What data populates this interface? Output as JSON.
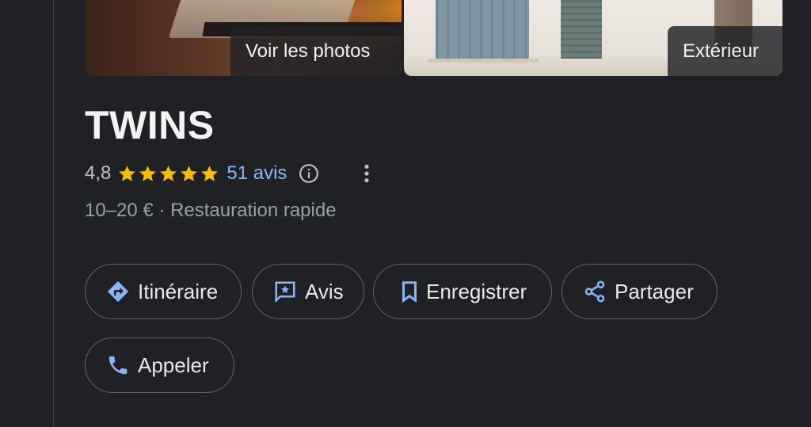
{
  "photos": {
    "primary_label": "Voir les photos",
    "secondary_label": "Extérieur"
  },
  "place": {
    "name": "TWINS",
    "rating": "4,8",
    "stars": 5,
    "reviews_link": "51 avis",
    "price_category": "10–20 € · Restauration rapide"
  },
  "actions": {
    "directions": "Itinéraire",
    "review": "Avis",
    "save": "Enregistrer",
    "share": "Partager",
    "call": "Appeler"
  },
  "icons": {
    "directions": "directions-icon",
    "review": "rate-review-icon",
    "save": "bookmark-icon",
    "share": "share-icon",
    "call": "phone-icon",
    "info": "info-icon",
    "more": "more-vert-icon"
  },
  "colors": {
    "background": "#202124",
    "accent": "#8ab4f8",
    "star": "#fbbc04",
    "chip_border": "#5f6368"
  }
}
